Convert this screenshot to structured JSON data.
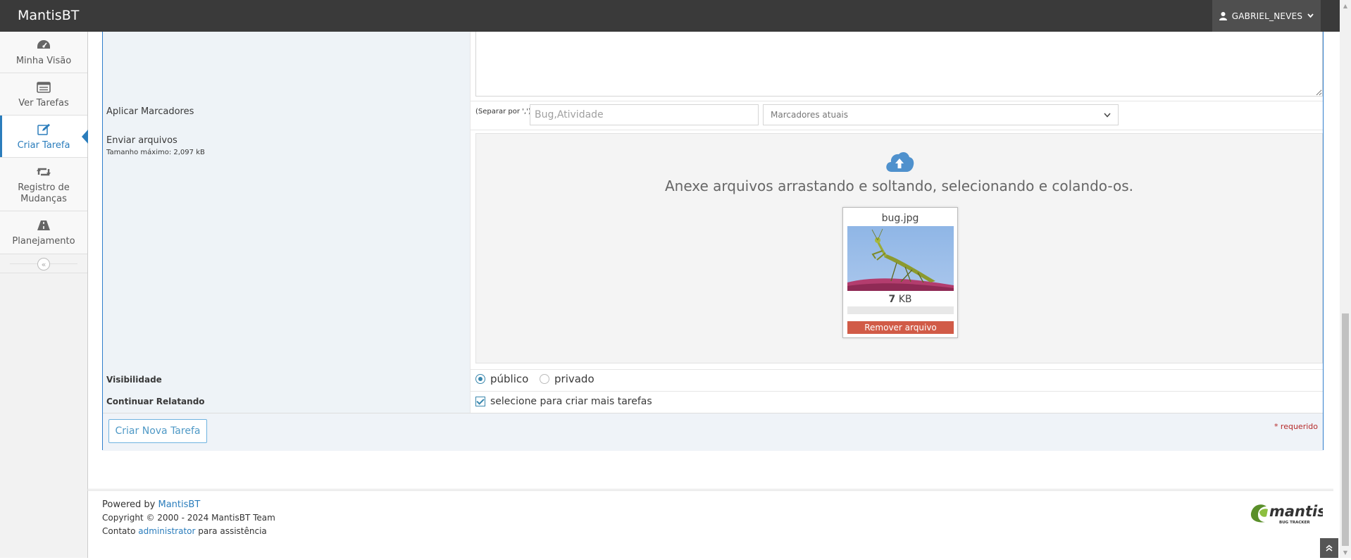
{
  "app": {
    "brand": "MantisBT"
  },
  "user": {
    "name": "GABRIEL_NEVES"
  },
  "sidebar": {
    "items": [
      {
        "label": "Minha Visão",
        "icon": "dashboard-icon"
      },
      {
        "label": "Ver Tarefas",
        "icon": "list-icon"
      },
      {
        "label": "Criar Tarefa",
        "icon": "edit-icon",
        "active": true
      },
      {
        "label": "Registro de Mudanças",
        "icon": "retweet-icon"
      },
      {
        "label": "Planejamento",
        "icon": "road-icon"
      }
    ]
  },
  "form": {
    "tags": {
      "label": "Aplicar Marcadores",
      "hint": "(Separar por ',')",
      "placeholder": "Bug,Atividade",
      "select": "Marcadores atuais"
    },
    "files": {
      "label": "Enviar arquivos",
      "max_size": "Tamanho máximo: 2,097 kB",
      "drop_text": "Anexe arquivos arrastando e soltando, selecionando e colando-os.",
      "file": {
        "name": "bug.jpg",
        "size_value": "7",
        "size_unit": "KB",
        "remove": "Remover arquivo"
      }
    },
    "visibility": {
      "label": "Visibilidade",
      "public": "público",
      "private": "privado"
    },
    "continue": {
      "label": "Continuar Relatando",
      "checkbox": "selecione para criar mais tarefas"
    },
    "submit": "Criar Nova Tarefa",
    "required": "* requerido"
  },
  "footer": {
    "powered_prefix": "Powered by",
    "powered_link": "MantisBT",
    "copyright": "Copyright © 2000 - 2024 MantisBT Team",
    "contact_prefix": "Contato",
    "contact_link": "administrator",
    "contact_suffix": "para assistência",
    "logo_main": "mantis",
    "logo_sub": "BUG TRACKER"
  },
  "colors": {
    "navbar": "#3a3a3a",
    "accent": "#2b7dbc",
    "danger": "#d15b47"
  }
}
